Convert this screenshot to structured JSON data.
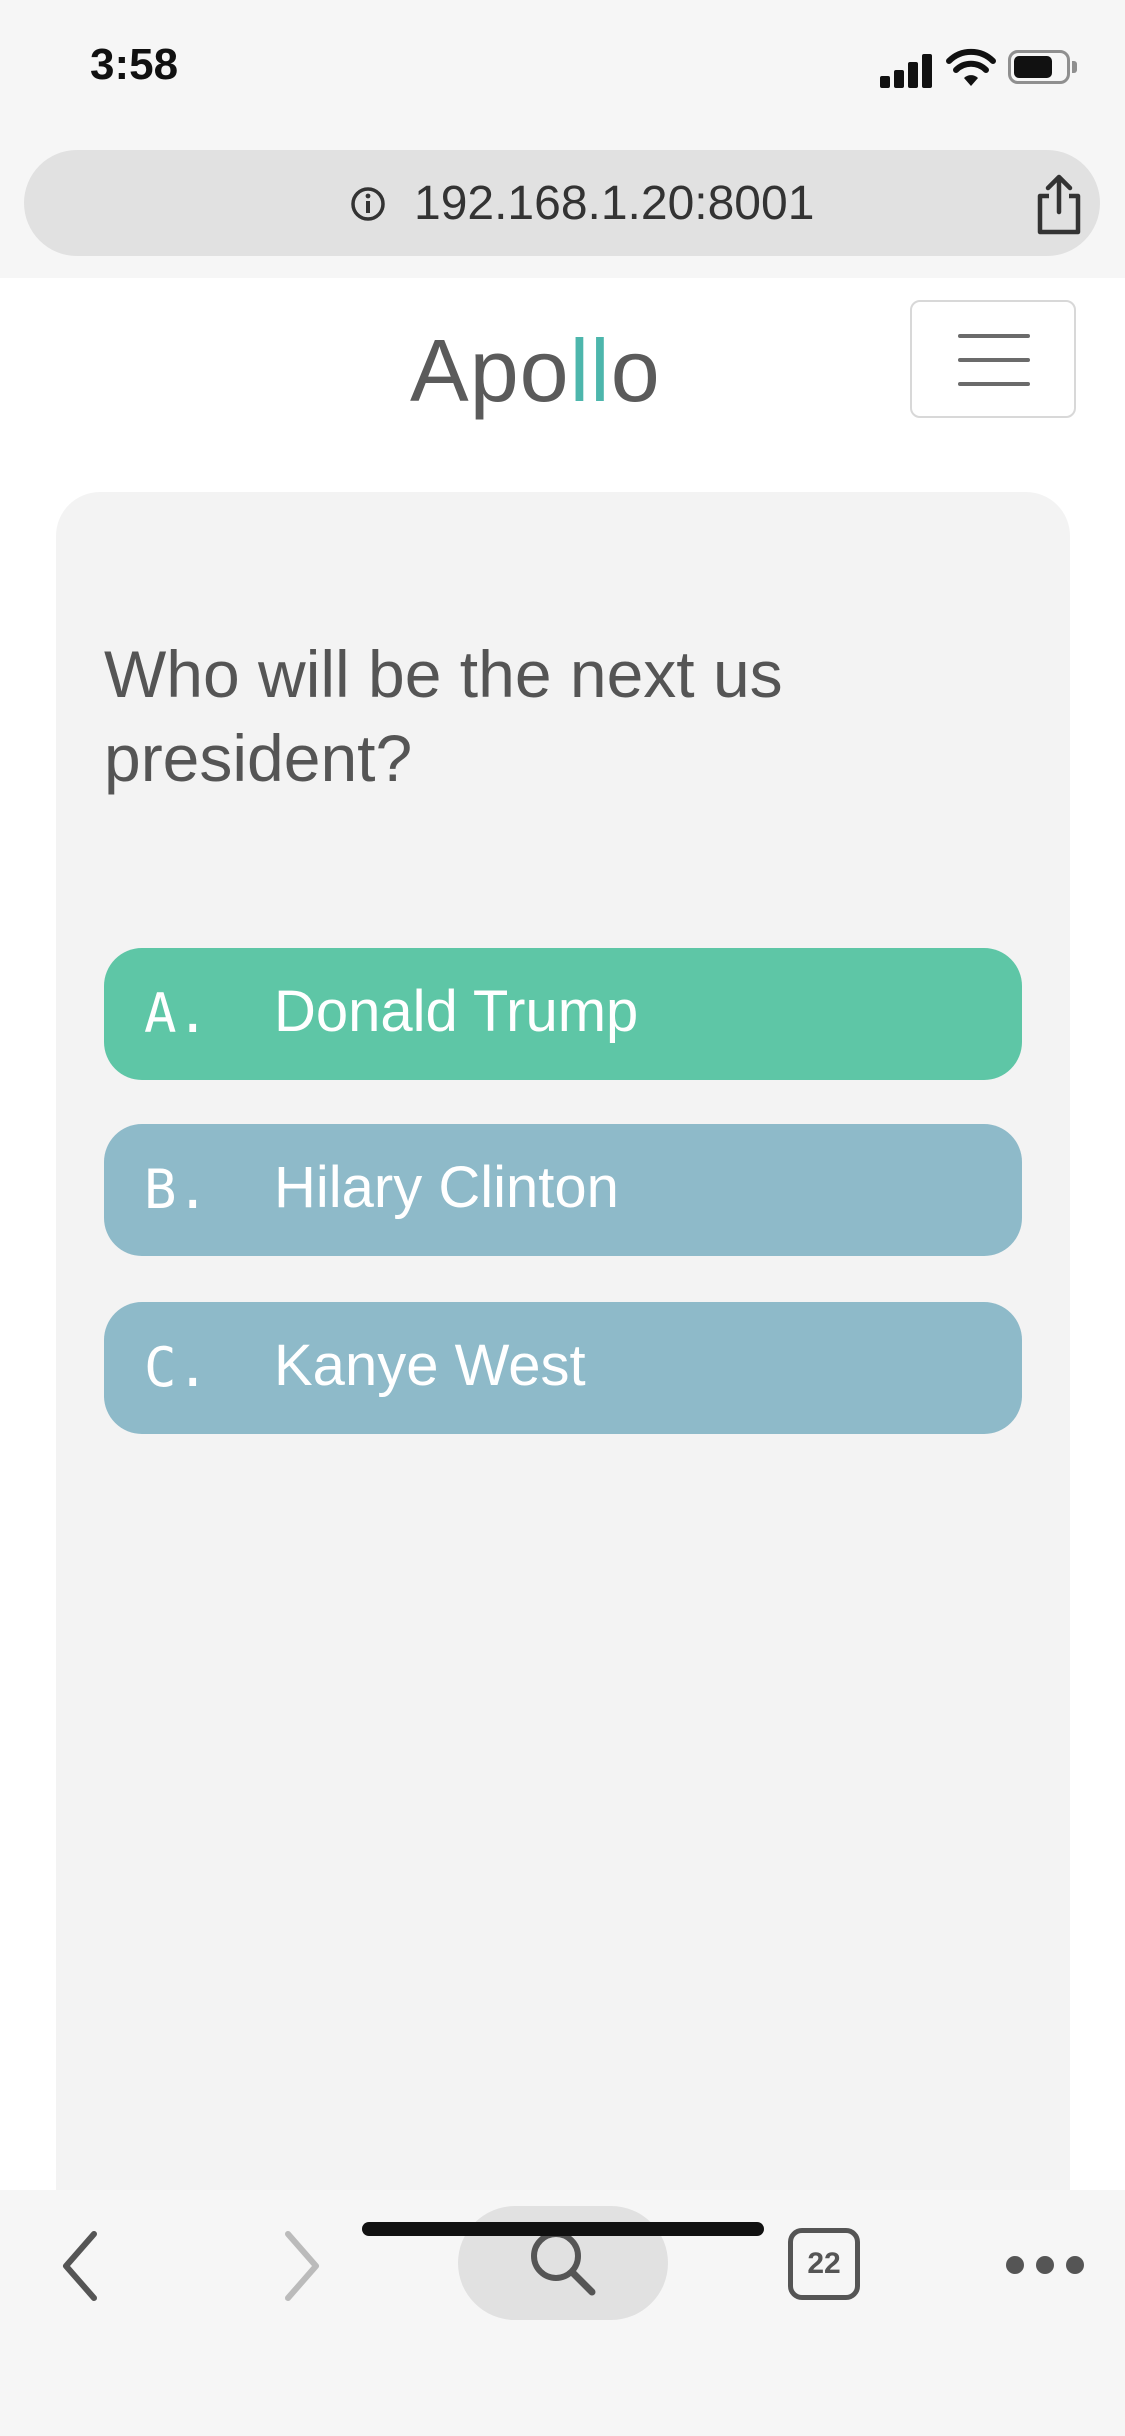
{
  "status_bar": {
    "time": "3:58"
  },
  "browser": {
    "url": "192.168.1.20:8001",
    "tab_count": "22"
  },
  "header": {
    "logo_prefix": "Apo",
    "logo_accent": "ll",
    "logo_suffix": "o"
  },
  "quiz": {
    "question": "Who will be the next us president?",
    "options": [
      {
        "letter": "A.",
        "label": "Donald Trump",
        "selected": true
      },
      {
        "letter": "B.",
        "label": "Hilary Clinton",
        "selected": false
      },
      {
        "letter": "C.",
        "label": "Kanye West",
        "selected": false
      }
    ]
  },
  "colors": {
    "selected_option": "#5ec6a6",
    "option": "#8ebac9",
    "logo_accent": "#4db6ac"
  },
  "icons": [
    "info-icon",
    "share-icon",
    "menu-icon",
    "back-icon",
    "forward-icon",
    "search-icon",
    "tabs-icon",
    "more-icon"
  ]
}
